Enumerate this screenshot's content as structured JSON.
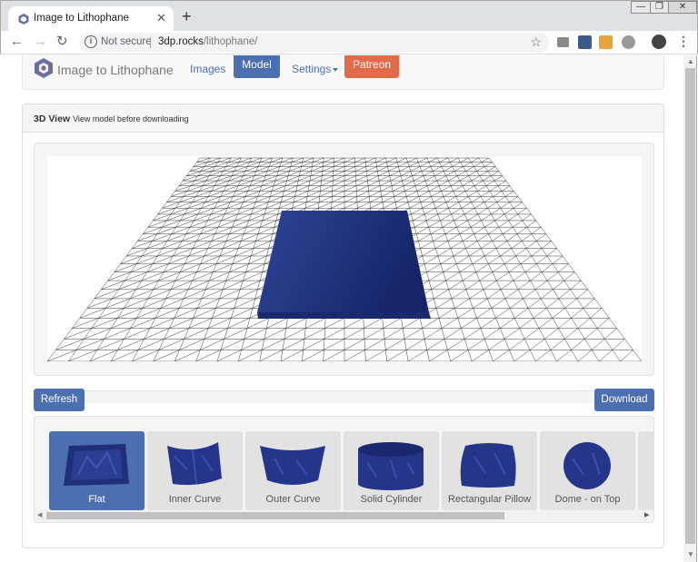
{
  "browser": {
    "tab_title": "Image to Lithophane",
    "tab_close": "✕",
    "new_tab": "+",
    "win_min": "—",
    "win_max": "❐",
    "win_close": "✕",
    "not_secure": "Not secure",
    "url_host": "3dp.rocks",
    "url_path": "/lithophane/",
    "icons": [
      "back-icon",
      "forward-icon",
      "reload-icon",
      "info-icon",
      "star-icon",
      "camera-icon",
      "extension-icon",
      "pdf-extension-icon",
      "globe-icon",
      "avatar-icon",
      "menu-icon"
    ]
  },
  "navbar": {
    "brand": "Image to Lithophane",
    "images": "Images",
    "model": "Model",
    "settings": "Settings",
    "patreon": "Patreon"
  },
  "panel": {
    "title": "3D View",
    "subtitle": "View model before downloading"
  },
  "actions": {
    "refresh": "Refresh",
    "download": "Download"
  },
  "shapes": [
    {
      "label": "Flat",
      "active": true
    },
    {
      "label": "Inner Curve",
      "active": false
    },
    {
      "label": "Outer Curve",
      "active": false
    },
    {
      "label": "Solid Cylinder",
      "active": false
    },
    {
      "label": "Rectangular Pillow",
      "active": false
    },
    {
      "label": "Dome - on Top",
      "active": false
    }
  ],
  "colors": {
    "primary": "#4c6fb0",
    "patreon": "#e06a4a",
    "model": "#1f2f7a"
  }
}
